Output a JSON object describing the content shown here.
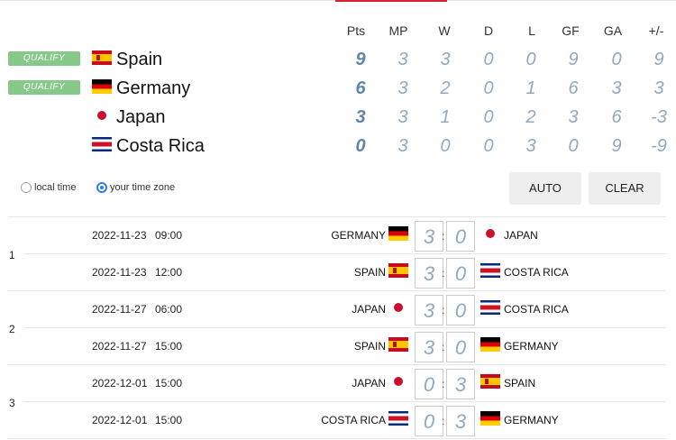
{
  "headers": {
    "pts": "Pts",
    "mp": "MP",
    "w": "W",
    "d": "D",
    "l": "L",
    "gf": "GF",
    "ga": "GA",
    "diff": "+/-"
  },
  "standings": [
    {
      "qualify": "QUALIFY",
      "flag": "flag-es",
      "team": "Spain",
      "pts": "9",
      "mp": "3",
      "w": "3",
      "d": "0",
      "l": "0",
      "gf": "9",
      "ga": "0",
      "diff": "9"
    },
    {
      "qualify": "QUALIFY",
      "flag": "flag-de",
      "team": "Germany",
      "pts": "6",
      "mp": "3",
      "w": "2",
      "d": "0",
      "l": "1",
      "gf": "6",
      "ga": "3",
      "diff": "3"
    },
    {
      "qualify": "",
      "flag": "flag-jp",
      "team": "Japan",
      "pts": "3",
      "mp": "3",
      "w": "1",
      "d": "0",
      "l": "2",
      "gf": "3",
      "ga": "6",
      "diff": "-3"
    },
    {
      "qualify": "",
      "flag": "flag-cr",
      "team": "Costa Rica",
      "pts": "0",
      "mp": "3",
      "w": "0",
      "d": "0",
      "l": "3",
      "gf": "0",
      "ga": "9",
      "diff": "-9"
    }
  ],
  "timezone": {
    "local": "local time",
    "yours": "your time zone",
    "selected": "yours"
  },
  "buttons": {
    "auto": "AUTO",
    "clear": "CLEAR"
  },
  "rounds": [
    "1",
    "2",
    "3"
  ],
  "matches": [
    {
      "date": "2022-11-23",
      "time": "09:00",
      "home": "GERMANY",
      "home_flag": "flag-de",
      "home_score": "3",
      "away_score": "0",
      "away": "JAPAN",
      "away_flag": "flag-jp"
    },
    {
      "date": "2022-11-23",
      "time": "12:00",
      "home": "SPAIN",
      "home_flag": "flag-es",
      "home_score": "3",
      "away_score": "0",
      "away": "COSTA RICA",
      "away_flag": "flag-cr"
    },
    {
      "date": "2022-11-27",
      "time": "06:00",
      "home": "JAPAN",
      "home_flag": "flag-jp",
      "home_score": "3",
      "away_score": "0",
      "away": "COSTA RICA",
      "away_flag": "flag-cr"
    },
    {
      "date": "2022-11-27",
      "time": "15:00",
      "home": "SPAIN",
      "home_flag": "flag-es",
      "home_score": "3",
      "away_score": "0",
      "away": "GERMANY",
      "away_flag": "flag-de"
    },
    {
      "date": "2022-12-01",
      "time": "15:00",
      "home": "JAPAN",
      "home_flag": "flag-jp",
      "home_score": "0",
      "away_score": "3",
      "away": "SPAIN",
      "away_flag": "flag-es"
    },
    {
      "date": "2022-12-01",
      "time": "15:00",
      "home": "COSTA RICA",
      "home_flag": "flag-cr",
      "home_score": "0",
      "away_score": "3",
      "away": "GERMANY",
      "away_flag": "flag-de"
    }
  ],
  "colors": {
    "qualify": "#86c98a",
    "accent": "#d9232e",
    "score": "#8fa9c2",
    "points": "#5e86ad",
    "radio": "#2b7de9"
  }
}
